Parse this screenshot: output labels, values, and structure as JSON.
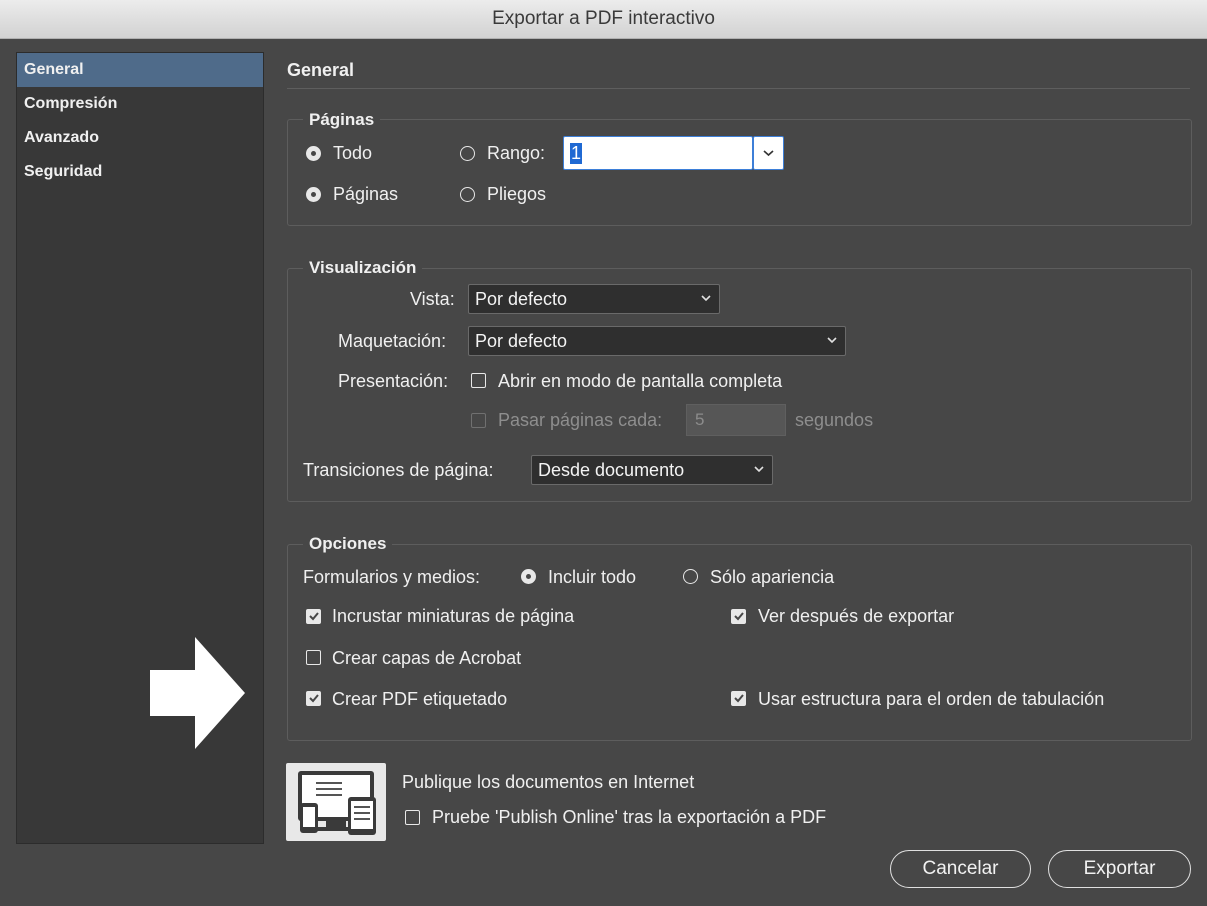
{
  "window": {
    "title": "Exportar a PDF interactivo"
  },
  "sidebar": {
    "items": [
      {
        "label": "General",
        "selected": true
      },
      {
        "label": "Compresión"
      },
      {
        "label": "Avanzado"
      },
      {
        "label": "Seguridad"
      }
    ]
  },
  "main": {
    "title": "General"
  },
  "paginas": {
    "legend": "Páginas",
    "todo_label": "Todo",
    "rango_label": "Rango:",
    "range_value": "1",
    "paginas_label": "Páginas",
    "pliegos_label": "Pliegos"
  },
  "visualizacion": {
    "legend": "Visualización",
    "vista_label": "Vista:",
    "vista_value": "Por defecto",
    "maquetacion_label": "Maquetación:",
    "maquetacion_value": "Por defecto",
    "presentacion_label": "Presentación:",
    "fullscreen_label": "Abrir en modo de pantalla completa",
    "pasar_label": "Pasar páginas cada:",
    "pasar_value": "5",
    "segundos_label": "segundos",
    "transiciones_label": "Transiciones de página:",
    "transiciones_value": "Desde documento"
  },
  "opciones": {
    "legend": "Opciones",
    "formularios_label": "Formularios y medios:",
    "incluir_label": "Incluir todo",
    "solo_label": "Sólo apariencia",
    "miniaturas_label": "Incrustar miniaturas de página",
    "ver_label": "Ver después de exportar",
    "capas_label": "Crear capas de Acrobat",
    "etiquetado_label": "Crear PDF etiquetado",
    "estructura_label": "Usar estructura para el orden de tabulación"
  },
  "publish": {
    "title": "Publique los documentos en Internet",
    "checkbox_label": "Pruebe 'Publish Online' tras la exportación a PDF"
  },
  "buttons": {
    "cancel": "Cancelar",
    "export": "Exportar"
  },
  "icons": {
    "chevron": "chevron-down-icon",
    "check": "checkmark-icon",
    "arrow": "arrow-right-icon",
    "devices": "devices-icon"
  }
}
